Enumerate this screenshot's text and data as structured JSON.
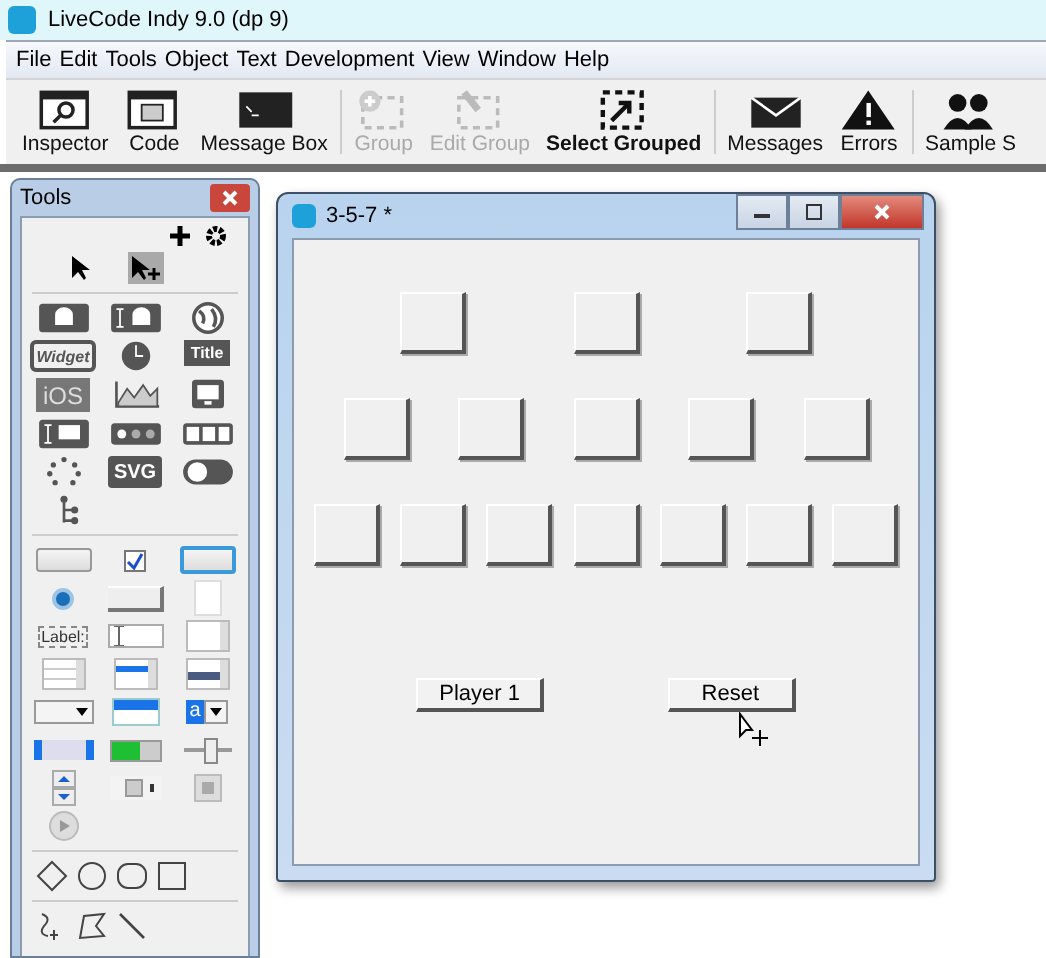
{
  "window": {
    "title": "LiveCode Indy 9.0 (dp 9)"
  },
  "menu": [
    "File",
    "Edit",
    "Tools",
    "Object",
    "Text",
    "Development",
    "View",
    "Window",
    "Help"
  ],
  "toolbar": [
    {
      "kind": "inspector",
      "label": "Inspector",
      "disabled": false,
      "highlighted": false
    },
    {
      "kind": "code",
      "label": "Code",
      "disabled": false,
      "highlighted": false
    },
    {
      "kind": "message-box",
      "label": "Message Box",
      "disabled": false,
      "highlighted": false
    },
    {
      "kind": "group",
      "label": "Group",
      "disabled": true,
      "highlighted": false
    },
    {
      "kind": "edit-group",
      "label": "Edit Group",
      "disabled": true,
      "highlighted": false
    },
    {
      "kind": "select-grouped",
      "label": "Select Grouped",
      "disabled": false,
      "highlighted": true
    },
    {
      "kind": "messages",
      "label": "Messages",
      "disabled": false,
      "highlighted": false
    },
    {
      "kind": "errors",
      "label": "Errors",
      "disabled": false,
      "highlighted": false
    },
    {
      "kind": "sample-stacks",
      "label": "Sample S",
      "disabled": false,
      "highlighted": false
    }
  ],
  "tools": {
    "title": "Tools",
    "pointers": [
      {
        "kind": "browse",
        "selected": false
      },
      {
        "kind": "edit",
        "selected": true
      }
    ],
    "widgets": [
      {
        "kind": "android-button"
      },
      {
        "kind": "android-field"
      },
      {
        "kind": "browser"
      },
      {
        "kind": "widget",
        "text": "Widget"
      },
      {
        "kind": "clock"
      },
      {
        "kind": "header",
        "text": "Title"
      },
      {
        "kind": "ios",
        "text": "iOS"
      },
      {
        "kind": "chart"
      },
      {
        "kind": "desktop"
      },
      {
        "kind": "field-desktop"
      },
      {
        "kind": "nav-bar"
      },
      {
        "kind": "segmented"
      },
      {
        "kind": "spinner"
      },
      {
        "kind": "svg",
        "text": "SVG"
      },
      {
        "kind": "switch"
      },
      {
        "kind": "tree"
      }
    ],
    "controls": [
      {
        "kind": "button"
      },
      {
        "kind": "checkbox",
        "checked": true
      },
      {
        "kind": "default-button"
      },
      {
        "kind": "radio"
      },
      {
        "kind": "rect-button"
      },
      {
        "kind": "page"
      },
      {
        "kind": "label",
        "text": "Label:"
      },
      {
        "kind": "field"
      },
      {
        "kind": "scroll-field"
      },
      {
        "kind": "table"
      },
      {
        "kind": "list"
      },
      {
        "kind": "scroll-list"
      },
      {
        "kind": "option-menu"
      },
      {
        "kind": "combo"
      },
      {
        "kind": "combo-box",
        "text": "a"
      },
      {
        "kind": "scrollbar"
      },
      {
        "kind": "progress",
        "level": 0.6
      },
      {
        "kind": "slider",
        "level": 0.55
      },
      {
        "kind": "little-arrows"
      },
      {
        "kind": "player"
      },
      {
        "kind": "image"
      },
      {
        "kind": "graphic"
      }
    ],
    "shapes": [
      {
        "kind": "diamond"
      },
      {
        "kind": "circle"
      },
      {
        "kind": "rounded"
      },
      {
        "kind": "rectangle"
      }
    ],
    "paint": [
      {
        "kind": "freehand"
      },
      {
        "kind": "polygon"
      },
      {
        "kind": "line"
      }
    ]
  },
  "stack": {
    "title": "3-5-7 *",
    "rows": [
      {
        "buttons": [
          {
            "kind": "blank"
          },
          {
            "kind": "blank"
          },
          {
            "kind": "blank"
          }
        ]
      },
      {
        "buttons": [
          {
            "kind": "blank"
          },
          {
            "kind": "blank"
          },
          {
            "kind": "blank"
          },
          {
            "kind": "blank"
          },
          {
            "kind": "blank"
          }
        ]
      },
      {
        "buttons": [
          {
            "kind": "blank"
          },
          {
            "kind": "blank"
          },
          {
            "kind": "blank"
          },
          {
            "kind": "blank"
          },
          {
            "kind": "blank"
          },
          {
            "kind": "blank"
          },
          {
            "kind": "blank"
          }
        ]
      }
    ],
    "actions": [
      "Player 1",
      "Reset"
    ]
  }
}
